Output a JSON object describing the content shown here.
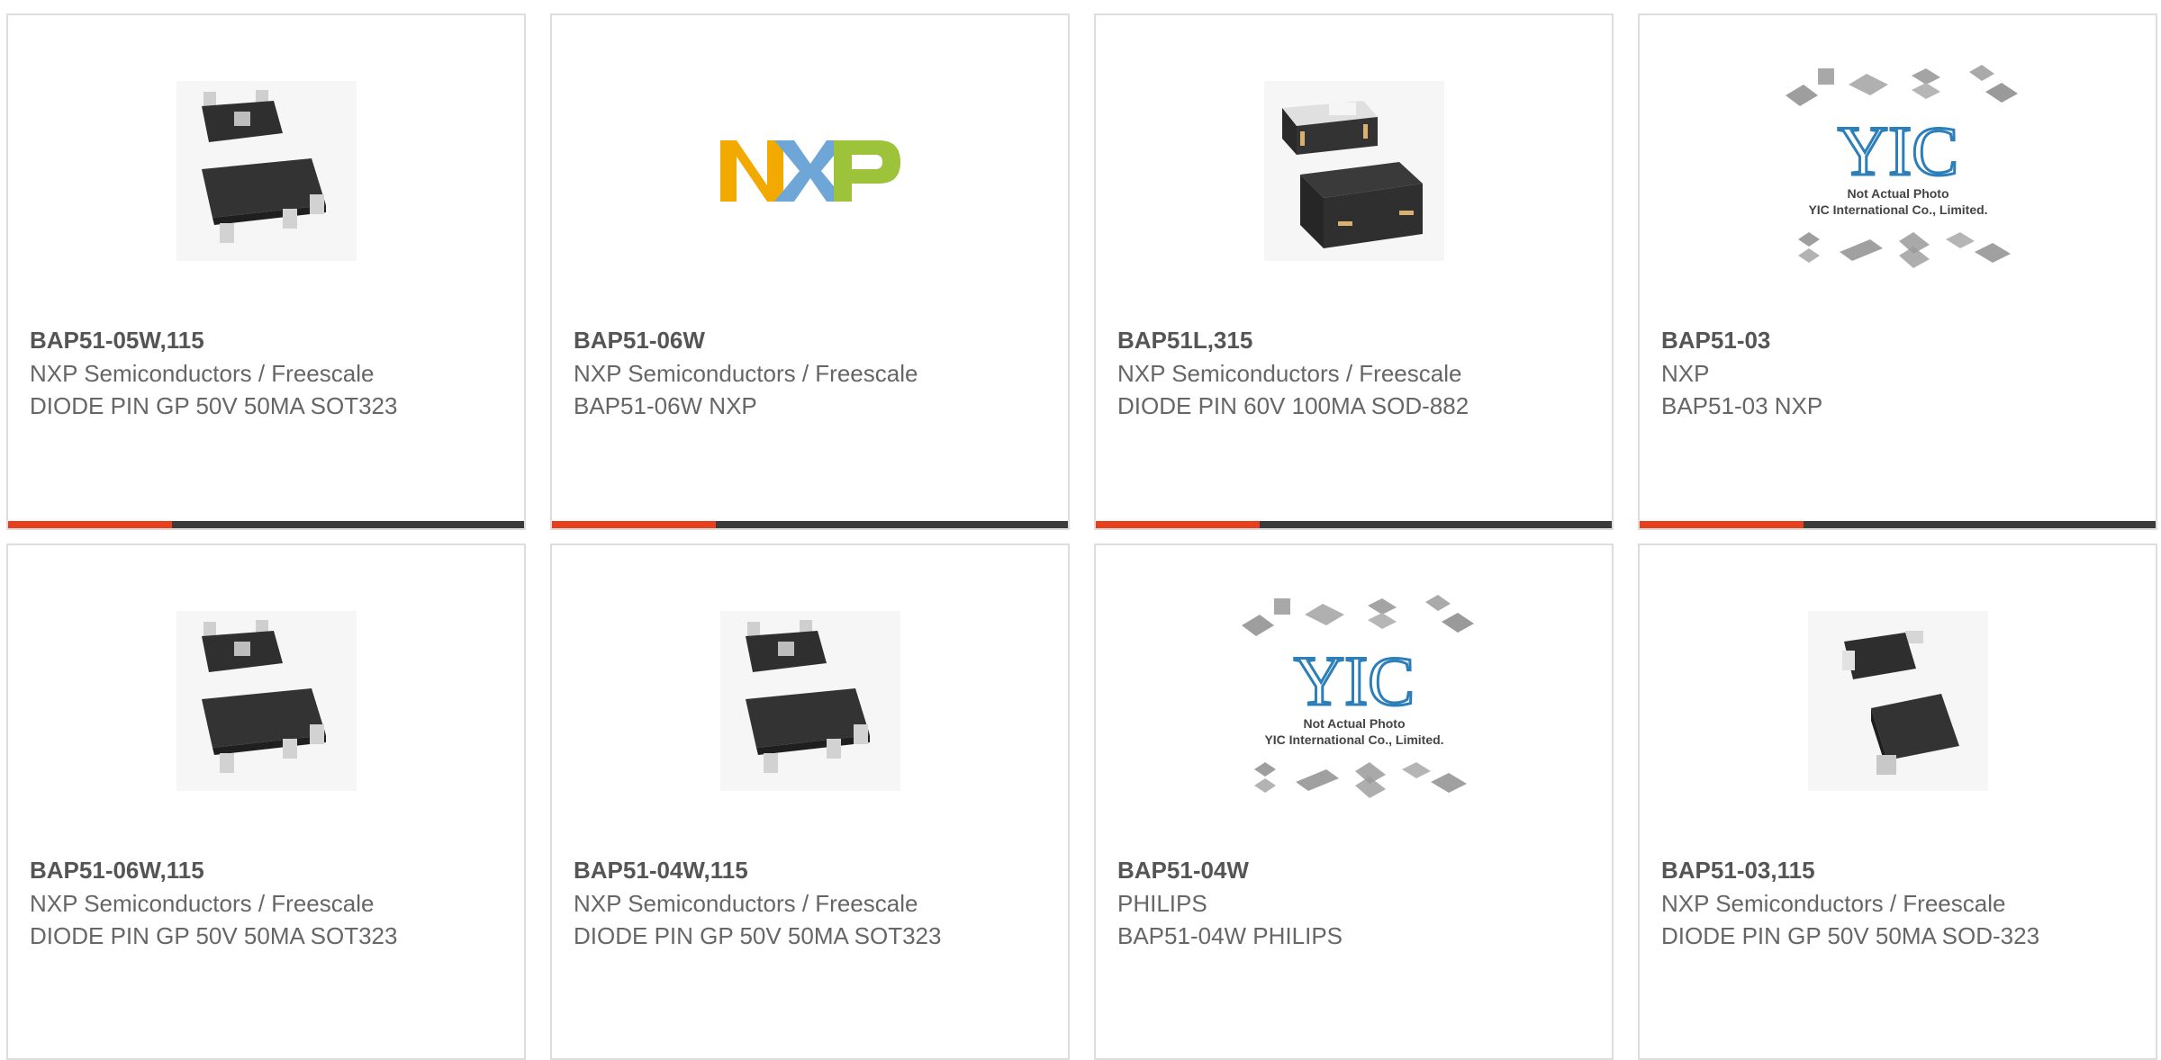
{
  "colors": {
    "accent": "#e8401c",
    "bar_dark": "#3b3b3b",
    "card_border": "#dddddd",
    "text": "#666666"
  },
  "products": [
    {
      "part_number": "BAP51-05W,115",
      "manufacturer": "NXP Semiconductors / Freescale",
      "description": "DIODE PIN GP 50V 50MA SOT323",
      "image": "sot323-package-image"
    },
    {
      "part_number": "BAP51-06W",
      "manufacturer": "NXP Semiconductors / Freescale",
      "description": "BAP51-06W NXP",
      "image": "nxp-logo-image"
    },
    {
      "part_number": "BAP51L,315",
      "manufacturer": "NXP Semiconductors / Freescale",
      "description": "DIODE PIN 60V 100MA SOD-882",
      "image": "sod882-package-image"
    },
    {
      "part_number": "BAP51-03",
      "manufacturer": "NXP",
      "description": "BAP51-03 NXP",
      "image": "yic-placeholder-image",
      "placeholder": {
        "logo": "YIC",
        "line1": "Not Actual Photo",
        "line2": "YIC International Co., Limited."
      }
    },
    {
      "part_number": "BAP51-06W,115",
      "manufacturer": "NXP Semiconductors / Freescale",
      "description": "DIODE PIN GP 50V 50MA SOT323",
      "image": "sot323-package-image"
    },
    {
      "part_number": "BAP51-04W,115",
      "manufacturer": "NXP Semiconductors / Freescale",
      "description": "DIODE PIN GP 50V 50MA SOT323",
      "image": "sot323-package-image"
    },
    {
      "part_number": "BAP51-04W",
      "manufacturer": "PHILIPS",
      "description": "BAP51-04W PHILIPS",
      "image": "yic-placeholder-image",
      "placeholder": {
        "logo": "YIC",
        "line1": "Not Actual Photo",
        "line2": "YIC International Co., Limited."
      }
    },
    {
      "part_number": "BAP51-03,115",
      "manufacturer": "NXP Semiconductors / Freescale",
      "description": "DIODE PIN GP 50V 50MA SOD-323",
      "image": "sod323-package-image"
    }
  ]
}
